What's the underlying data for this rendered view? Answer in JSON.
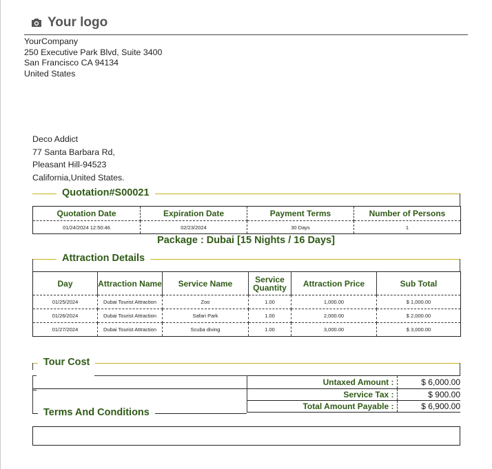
{
  "logo": {
    "text": "Your logo",
    "icon": "camera-icon"
  },
  "company": {
    "name": "YourCompany",
    "address_line1": "250 Executive Park Blvd, Suite 3400",
    "address_line2": "San Francisco CA 94134",
    "country": "United States"
  },
  "customer": {
    "name": "Deco Addict",
    "street": "77 Santa Barbara Rd,",
    "city": "Pleasant Hill-94523",
    "state": "California,United States."
  },
  "quotation": {
    "title": "Quotation#S00021",
    "headers": [
      "Quotation Date",
      "Expiration Date",
      "Payment Terms",
      "Number of Persons"
    ],
    "values": [
      "01/24/2024 12:50:46",
      "02/23/2024",
      "30 Days",
      "1"
    ]
  },
  "package": "Package : Dubai [15 Nights / 16 Days]",
  "attraction": {
    "title": "Attraction Details",
    "headers": [
      "Day",
      "Attraction Name",
      "Service Name",
      "Service Quantity",
      "Attraction Price",
      "Sub Total"
    ],
    "rows": [
      [
        "01/25/2024",
        "Dubai Tourist Attraction",
        "Zoo",
        "1.00",
        "1,000.00",
        "$ 1,000.00"
      ],
      [
        "01/26/2024",
        "Dubai Tourist Attraction",
        "Safari Park",
        "1.00",
        "2,000.00",
        "$ 2,000.00"
      ],
      [
        "01/27/2024",
        "Dubai Tourist Attraction",
        "Scuba diving",
        "1.00",
        "3,000.00",
        "$ 3,000.00"
      ]
    ]
  },
  "tour_cost": {
    "title": "Tour Cost",
    "untaxed_label": "Untaxed Amount :",
    "untaxed_value": "$ 6,000.00",
    "tax_label": "Service Tax :",
    "tax_value": "$ 900.00",
    "total_label": "Total Amount Payable :",
    "total_value": "$ 6,900.00"
  },
  "terms": {
    "title": "Terms And Conditions"
  },
  "colors": {
    "accent_text": "#2f5a16",
    "accent_line": "#c9b21a"
  }
}
